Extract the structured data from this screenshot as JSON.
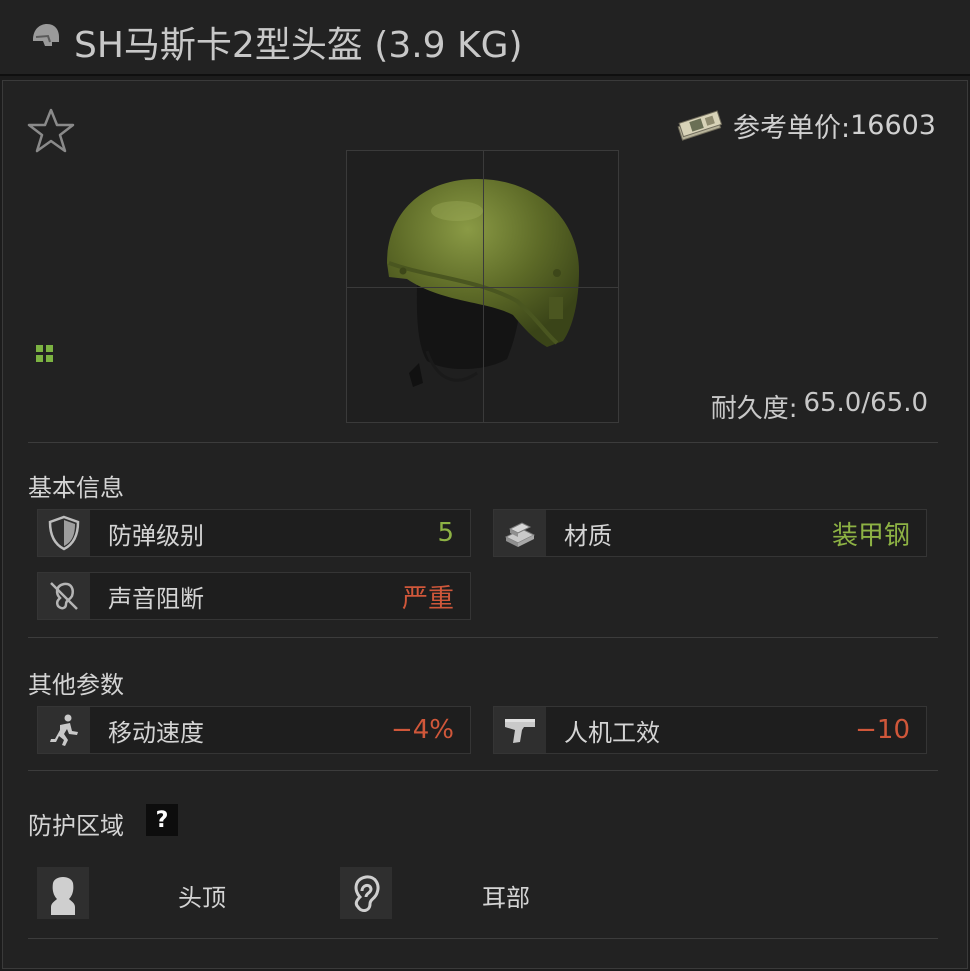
{
  "item": {
    "title": "SH马斯卡2型头盔 (3.9 KG)",
    "title_icon": "helmet-icon",
    "price_label": "参考单价:",
    "price_value": "16603",
    "durability_label": "耐久度:",
    "durability_value": "65.0/65.0"
  },
  "basic_info": {
    "title": "基本信息",
    "stats": [
      {
        "label": "防弹级别",
        "value": "5",
        "icon": "shield-icon",
        "color": "#8db244"
      },
      {
        "label": "材质",
        "value": "装甲钢",
        "icon": "armor-plates-icon",
        "color": "#8db244"
      },
      {
        "label": "声音阻断",
        "value": "严重",
        "icon": "ear-blocked-icon",
        "color": "#d0573a"
      }
    ]
  },
  "other_params": {
    "title": "其他参数",
    "stats": [
      {
        "label": "移动速度",
        "value": "−4%",
        "icon": "running-man-icon",
        "color": "#d0573a"
      },
      {
        "label": "人机工效",
        "value": "−10",
        "icon": "pistol-icon",
        "color": "#d0573a"
      }
    ]
  },
  "protection": {
    "title": "防护区域",
    "help": "?",
    "zones": [
      {
        "label": "头顶",
        "icon": "head-icon"
      },
      {
        "label": "耳部",
        "icon": "ear-icon"
      }
    ]
  }
}
